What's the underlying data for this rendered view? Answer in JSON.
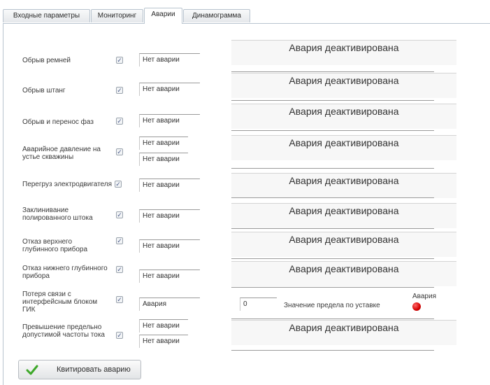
{
  "tabs": [
    {
      "label": "Входные параметры",
      "active": false
    },
    {
      "label": "Мониторинг",
      "active": false
    },
    {
      "label": "Аварии",
      "active": true
    },
    {
      "label": "Динамограмма",
      "active": false
    }
  ],
  "rows": [
    {
      "label": "Обрыв ремней",
      "checked": true,
      "fields": [
        "Нет аварии"
      ],
      "status": "Авария деактивирована"
    },
    {
      "label": "Обрыв штанг",
      "checked": true,
      "fields": [
        "Нет аварии"
      ],
      "status": "Авария деактивирована"
    },
    {
      "label": "Обрыв и перенос фаз",
      "checked": true,
      "fields": [
        "Нет аварии"
      ],
      "status": "Авария деактивирована"
    },
    {
      "label": "Аварийное давление на устье скважины",
      "checked": true,
      "fields": [
        "Нет аварии",
        "Нет аварии"
      ],
      "status": "Авария деактивирована"
    },
    {
      "label": "Перегруз электродвигателя",
      "checked": true,
      "fields": [
        "Нет аварии"
      ],
      "status": "Авария деактивирована"
    },
    {
      "label": "Заклинивание полированного штока",
      "checked": true,
      "fields": [
        "Нет аварии"
      ],
      "status": "Авария деактивирована"
    },
    {
      "label": "Отказ верхнего глубинного прибора",
      "checked": true,
      "fields": [
        "Нет аварии"
      ],
      "status": "Авария деактивирована"
    },
    {
      "label": "Отказ нижнего глубинного прибора",
      "checked": true,
      "fields": [
        "Нет аварии"
      ],
      "status": "Авария деактивирована"
    },
    {
      "label": "Потеря связи с интерфейсным блоком ГИК",
      "checked": true,
      "fields": [
        "Авария"
      ],
      "status": ""
    },
    {
      "label": "Превышение предельно допустимой частоты тока",
      "checked": true,
      "fields": [
        "Нет аварии",
        "Нет аварии"
      ],
      "status": "Авария деактивирована"
    }
  ],
  "limit": {
    "value": "0",
    "label": "Значение предела по уставке",
    "indicator_label": "Авария",
    "indicator_color": "#d40000"
  },
  "button": {
    "label": "Квитировать аварию",
    "icon": "check-icon"
  },
  "checkbox_glyph": "✓"
}
